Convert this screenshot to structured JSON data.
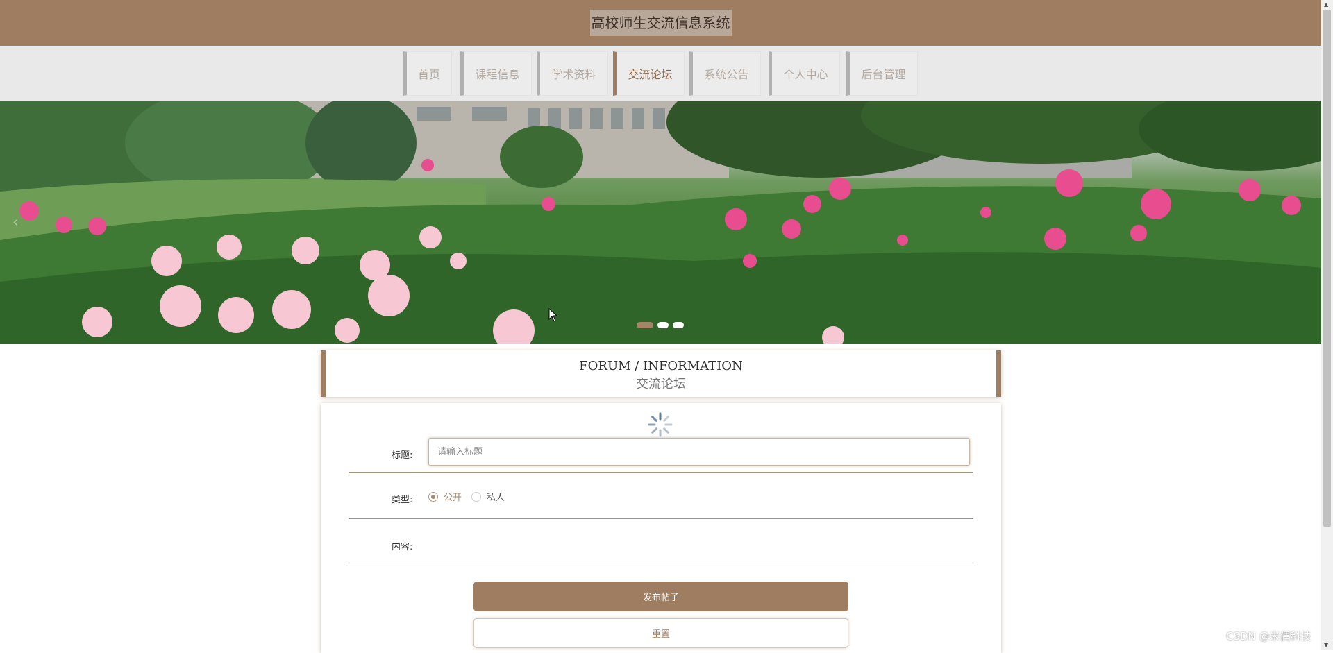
{
  "header": {
    "title": "高校师生交流信息系统"
  },
  "nav": {
    "items": [
      {
        "label": "首页",
        "active": false
      },
      {
        "label": "课程信息",
        "active": false
      },
      {
        "label": "学术资料",
        "active": false
      },
      {
        "label": "交流论坛",
        "active": true
      },
      {
        "label": "系统公告",
        "active": false
      },
      {
        "label": "个人中心",
        "active": false
      },
      {
        "label": "后台管理",
        "active": false
      }
    ]
  },
  "banner": {
    "prev_icon": "chevron-left-icon",
    "slide_count": 3,
    "active_slide": 1
  },
  "section": {
    "title_en": "FORUM / INFORMATION",
    "title_cn": "交流论坛"
  },
  "form": {
    "title_label": "标题:",
    "title_placeholder": "请输入标题",
    "title_value": "",
    "type_label": "类型:",
    "type_options": [
      "公开",
      "私人"
    ],
    "type_selected": "公开",
    "content_label": "内容:",
    "submit_label": "发布帖子",
    "reset_label": "重置",
    "loading_icon": "spinner-icon"
  },
  "watermark": "CSDN @米偶科技",
  "colors": {
    "brand": "#9f7d60",
    "nav_bg": "#e9e9e9",
    "title_highlight": "#b8a89a"
  }
}
